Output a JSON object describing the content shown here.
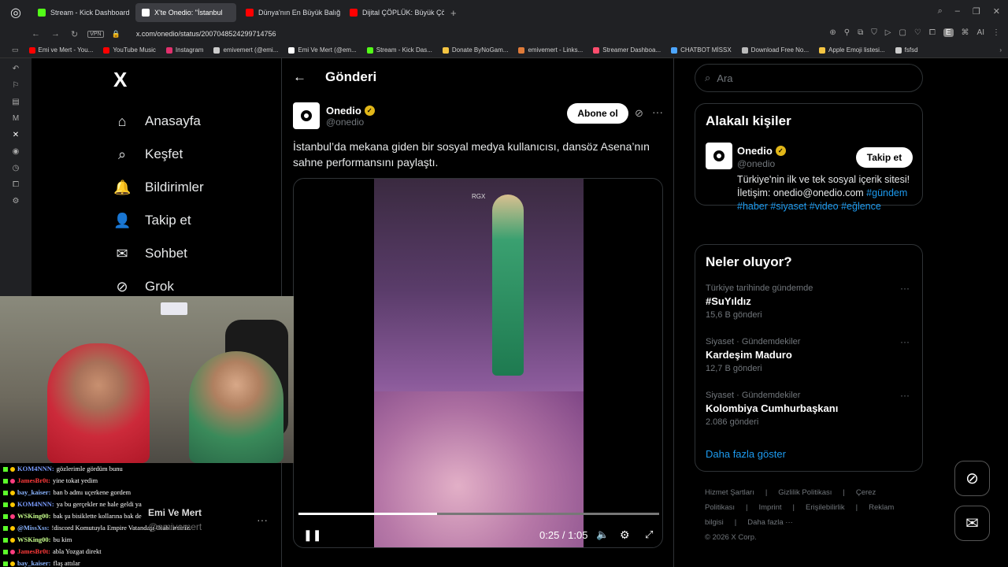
{
  "browser": {
    "tabs": [
      {
        "label": "Stream - Kick Dashboard",
        "color": "#53fc18",
        "active": false
      },
      {
        "label": "X'te Onedio: \"İstanbul",
        "color": "#ffffff",
        "active": true
      },
      {
        "label": "Dünya'nın En Büyük Balığı",
        "color": "#ff0000",
        "active": false
      },
      {
        "label": "Dijital ÇÖPLÜK: Büyük Çö",
        "color": "#ff0000",
        "active": false
      }
    ],
    "url": "x.com/onedio/status/2007048524299714756",
    "vpn": "VPN",
    "bookmarks": [
      {
        "label": "Emi ve Mert - You...",
        "color": "#ff0000"
      },
      {
        "label": "YouTube Music",
        "color": "#ff0000"
      },
      {
        "label": "Instagram",
        "color": "#e1306c"
      },
      {
        "label": "emivemert (@emi...",
        "color": "#cccccc"
      },
      {
        "label": "Emi Ve Mert (@em...",
        "color": "#ffffff"
      },
      {
        "label": "Stream - Kick Das...",
        "color": "#53fc18"
      },
      {
        "label": "Donate ByNoGam...",
        "color": "#f5c542"
      },
      {
        "label": "emivemert - Links...",
        "color": "#e07b39"
      },
      {
        "label": "Streamer Dashboa...",
        "color": "#ff4d6d"
      },
      {
        "label": "CHATBOT MİSSX",
        "color": "#4da6ff"
      },
      {
        "label": "Download Free No...",
        "color": "#bbbbbb"
      },
      {
        "label": "Apple Emoji listesi...",
        "color": "#f5c542"
      },
      {
        "label": "fsfsd",
        "color": "#cccccc"
      }
    ],
    "ext_ai": "AI"
  },
  "nav": {
    "logo": "X",
    "items": [
      {
        "label": "Anasayfa",
        "icon": "home-icon",
        "glyph": "⌂"
      },
      {
        "label": "Keşfet",
        "icon": "search-icon",
        "glyph": "⌕"
      },
      {
        "label": "Bildirimler",
        "icon": "bell-icon",
        "glyph": "🔔"
      },
      {
        "label": "Takip et",
        "icon": "person-add-icon",
        "glyph": "👤"
      },
      {
        "label": "Sohbet",
        "icon": "mail-icon",
        "glyph": "✉"
      },
      {
        "label": "Grok",
        "icon": "grok-icon",
        "glyph": "⊘"
      }
    ]
  },
  "post": {
    "header_title": "Gönderi",
    "author_name": "Onedio",
    "author_handle": "@onedio",
    "subscribe_label": "Abone ol",
    "text": "İstanbul’da mekana giden bir sosyal medya kullanıcısı, dansöz Asena’nın sahne performansını paylaştı.",
    "video": {
      "watermark": "RGX",
      "time": "0:25 / 1:05",
      "progress": 0.385
    }
  },
  "right": {
    "search_placeholder": "Ara",
    "related_title": "Alakalı kişiler",
    "related": {
      "name": "Onedio",
      "handle": "@onedio",
      "follow_label": "Takip et",
      "bio_text": "Türkiye'nin ilk ve tek sosyal içerik sitesi! İletişim: onedio@onedio.com",
      "tags": [
        "#gündem",
        "#haber",
        "#siyaset",
        "#video",
        "#eğlence"
      ]
    },
    "trends_title": "Neler oluyor?",
    "trends": [
      {
        "context": "Türkiye tarihinde gündemde",
        "name": "#SuYıldız",
        "count": "15,6 B gönderi"
      },
      {
        "context": "Siyaset · Gündemdekiler",
        "name": "Kardeşim Maduro",
        "count": "12,7 B gönderi"
      },
      {
        "context": "Siyaset · Gündemdekiler",
        "name": "Kolombiya Cumhurbaşkanı",
        "count": "2.086 gönderi"
      }
    ],
    "show_more": "Daha fazla göster",
    "footer_links": [
      "Hizmet Şartları",
      "|",
      "Gizlilik Politikası",
      "|",
      "Çerez Politikası",
      "|",
      "Imprint",
      "|",
      "Erişilebilirlik",
      "|",
      "Reklam bilgisi",
      "|",
      "Daha fazla ···"
    ],
    "copyright": "© 2026 X Corp."
  },
  "account": {
    "name": "Emi Ve Mert",
    "handle": "@emivemert"
  },
  "chat": [
    {
      "user": "KOM4NNN:",
      "cls": "u-kom",
      "msg": "gözlerimle gördüm bunu"
    },
    {
      "user": "JamesBr0t:",
      "cls": "u-james",
      "msg": "yine tokat yedim"
    },
    {
      "user": "bay_kaiser:",
      "cls": "u-bay",
      "msg": "ban b admı uçerkene gordem"
    },
    {
      "user": "KOM4NNN:",
      "cls": "u-kom",
      "msg": "ya bu gerçekler ne hale geldi ya"
    },
    {
      "user": "WSKing00:",
      "cls": "u-wsk",
      "msg": "bak şu bisiklette kollarına bak de"
    },
    {
      "user": "@MissXss:",
      "cls": "u-miss",
      "msg": "!discord Komutuyla Empire Vatandaşı Olabilirsiniz."
    },
    {
      "user": "WSKing00:",
      "cls": "u-wsk",
      "msg": "bu kim"
    },
    {
      "user": "JamesBr0t:",
      "cls": "u-james",
      "msg": "abla Yozgat direkt"
    },
    {
      "user": "bay_kaiser:",
      "cls": "u-bay",
      "msg": "flaş attılar"
    }
  ]
}
